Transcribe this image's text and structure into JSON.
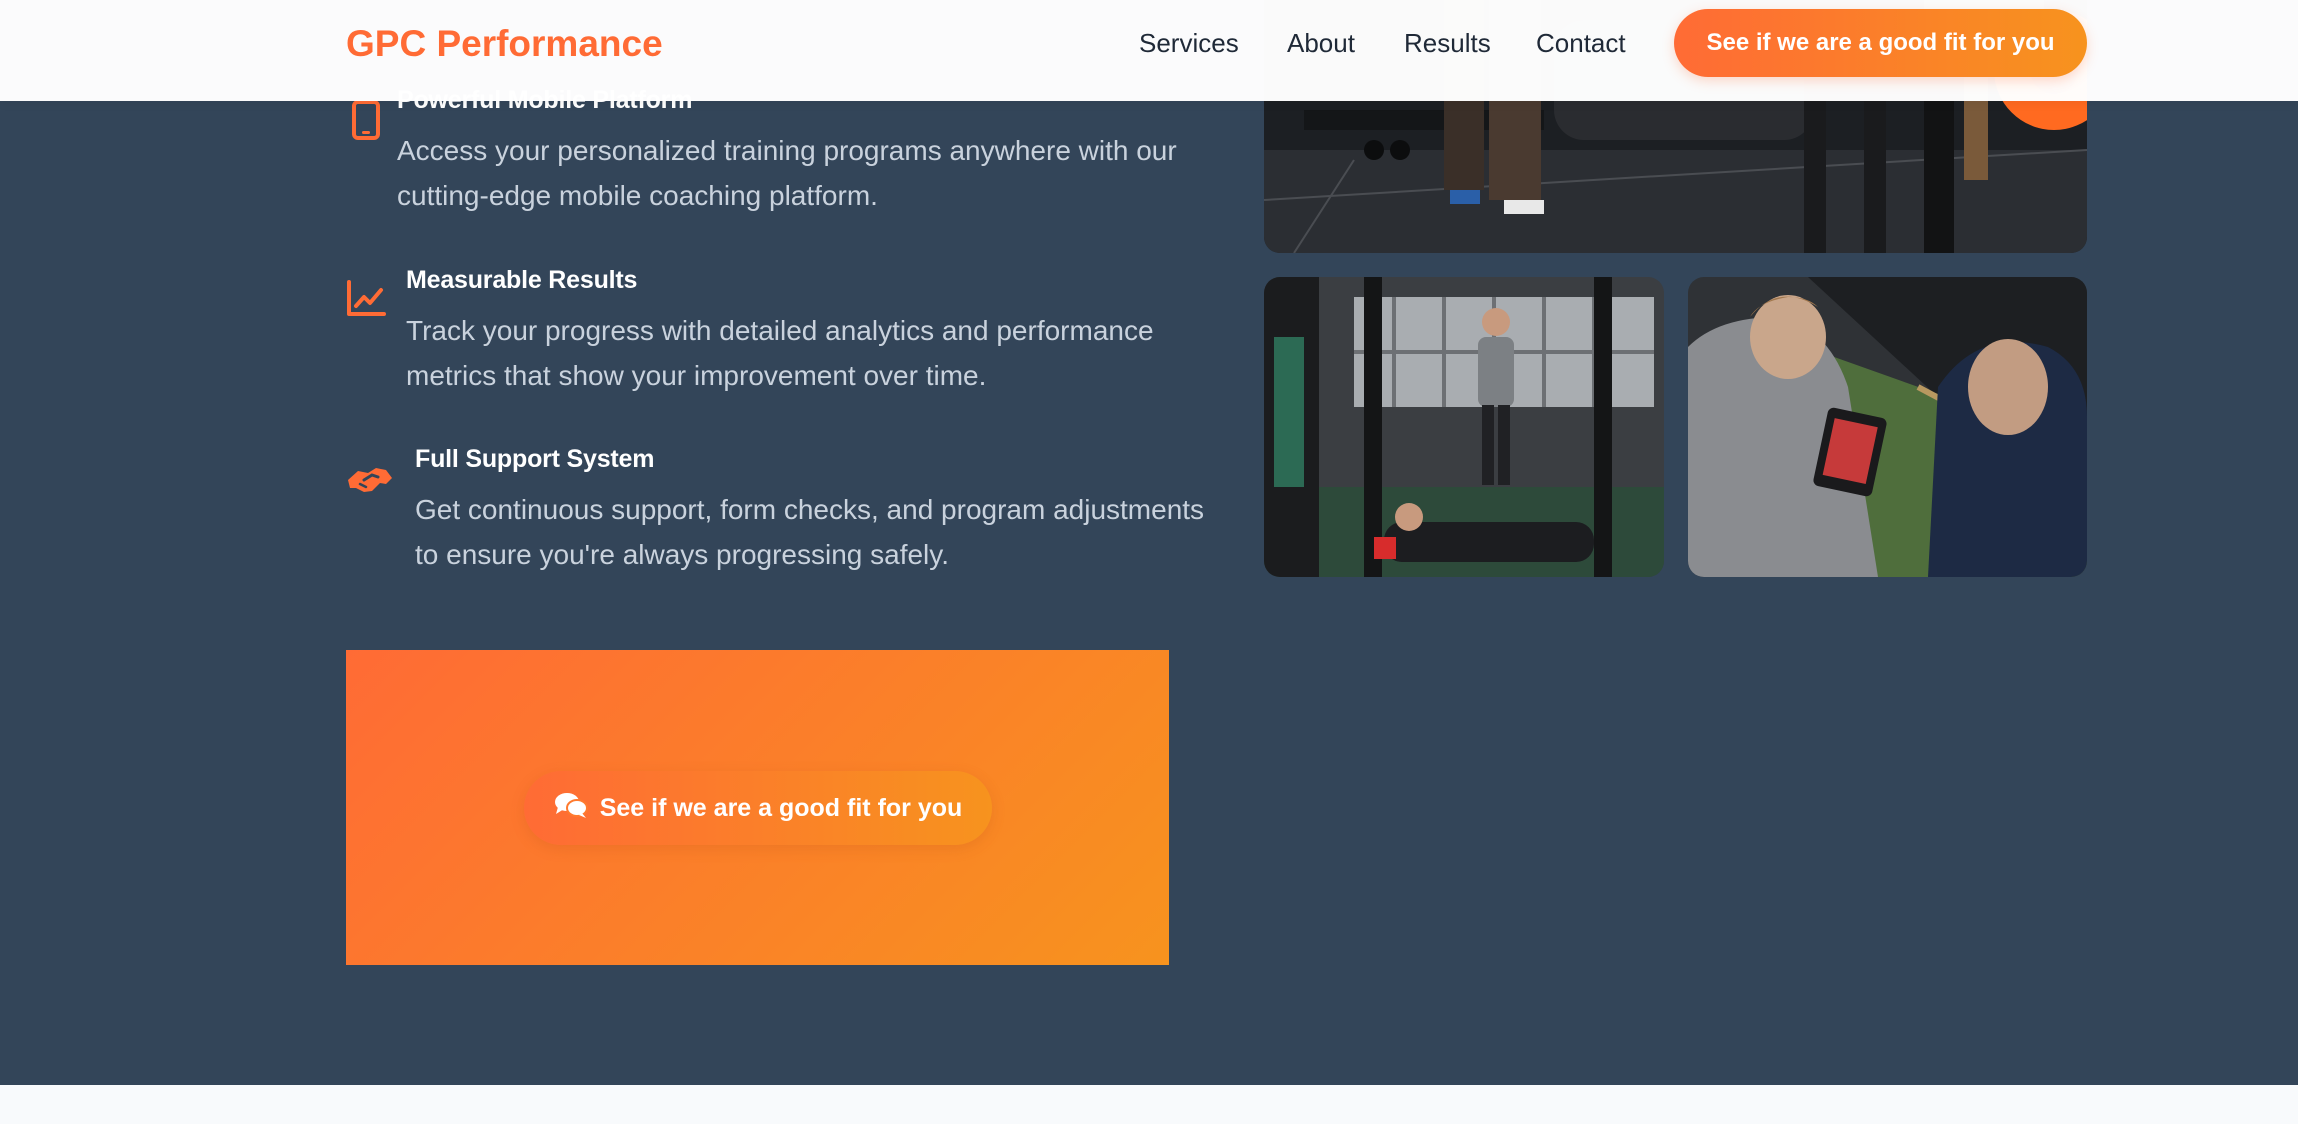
{
  "header": {
    "logo": "GPC Performance",
    "nav": {
      "services": "Services",
      "about": "About",
      "results": "Results",
      "contact": "Contact"
    },
    "cta_label": "See if we are a good fit for you"
  },
  "features": [
    {
      "icon": "mobile-phone-icon",
      "title": "Powerful Mobile Platform",
      "description": "Access your personalized training programs anywhere with our cutting-edge mobile coaching platform."
    },
    {
      "icon": "line-chart-icon",
      "title": "Measurable Results",
      "description": "Track your progress with detailed analytics and performance metrics that show your improvement over time."
    },
    {
      "icon": "handshake-icon",
      "title": "Full Support System",
      "description": "Get continuous support, form checks, and program adjustments to ensure you're always progressing safely."
    }
  ],
  "cta_section": {
    "button_label": "See if we are a good fit for you",
    "icon": "chat-bubbles-icon"
  },
  "colors": {
    "accent": "#ff6b35",
    "accent_secondary": "#f7931e",
    "section_background": "#334559",
    "page_background": "#f8fafc"
  }
}
